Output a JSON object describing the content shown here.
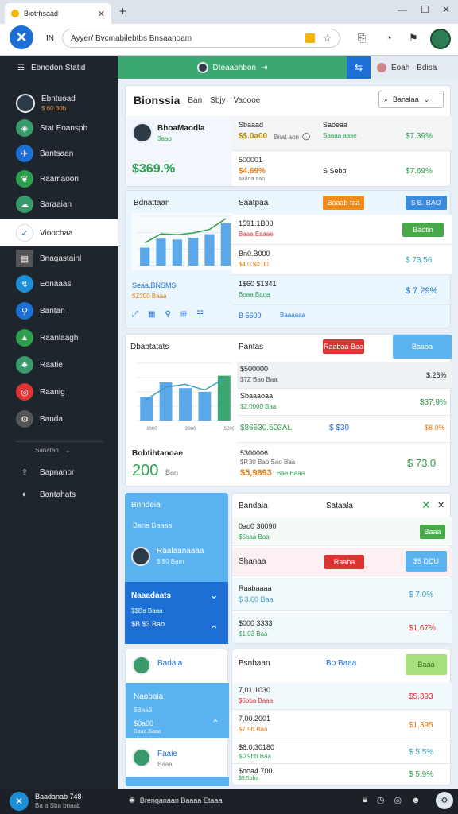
{
  "browser": {
    "tab_title": "Biotrhsaad",
    "new_tab": "+",
    "url_prefix": "IN",
    "url": "Ayyer/ Bvcmabilebtbs Bnsaanoam",
    "win_min": "—",
    "win_max": "☐",
    "win_close": "✕"
  },
  "strip": {
    "left_icon": "☷",
    "left_text": "Ebnodon   Statid",
    "mid_text": "Dteaabhbon",
    "mid_arrow": "⇥",
    "blue_icon": "⇆",
    "right_text": "Eoah  ·  Bdisa"
  },
  "sidebar": {
    "items": [
      {
        "label": "Ebntuoad",
        "sub": "$ 60.30b",
        "color": "#c0703a"
      },
      {
        "label": "Stat Eoansph",
        "color": "#3a9a6a"
      },
      {
        "label": "Bantsaan",
        "color": "#1d6fd6"
      },
      {
        "label": "Raamaoon",
        "color": "#2e9e4f"
      },
      {
        "label": "Saraaian",
        "color": "#3a9a6a"
      },
      {
        "label": "Vioochaa",
        "color": "#1d6fd6"
      },
      {
        "label": "Bnagastainl",
        "color": "#555"
      },
      {
        "label": "Eonaaas",
        "color": "#1d8fd6"
      },
      {
        "label": "Bantan",
        "color": "#1d6fd6"
      },
      {
        "label": "Raanlaagh",
        "color": "#2e9e4f"
      },
      {
        "label": "Raatie",
        "color": "#3a9a6a"
      },
      {
        "label": "Raanig",
        "color": "#d33"
      },
      {
        "label": "Banda",
        "color": "#555"
      }
    ],
    "section_label": "Sanatan",
    "bottom_items": [
      {
        "label": "Bapnanor"
      },
      {
        "label": "Bantahats"
      }
    ]
  },
  "panel1": {
    "title": "Bionssia",
    "tabs": [
      "Ban",
      "Sbjy",
      "Vaoooe"
    ],
    "search_label": "Banslaa",
    "profile_name": "BhoaMaodla",
    "profile_sub": "3aao",
    "profile_value": "$369.%",
    "col_a_label": "Sbaaad",
    "col_a_value": "$$.0a00",
    "col_a_sub": "Bnat  aon",
    "col_b_label": "Saoeaa",
    "col_b_value": "Saaaa aase",
    "col_c_value": "$7.39%",
    "row2_label": "500001",
    "row2_value": "$4.69%",
    "row2_sub": "aaaoa aan",
    "row2_mid": "S  Sebb",
    "row2_right": "$7.69%"
  },
  "panel2": {
    "title": "Bdnattaan",
    "subtitle": "Saatpaa",
    "orange_btn": "Boaab faa",
    "blue_btn": "$ B. BAO",
    "left_sub_title": "Seaa.BNSMS",
    "left_sub_value": "$Z300  Baaa",
    "rows": [
      {
        "label": "1591.1B00",
        "sub": "Baaa  Esaae",
        "right": "Badtin"
      },
      {
        "label": "Bn0.B000",
        "sub": "$4.0.$0.00",
        "right": "$ 73.56"
      },
      {
        "label": "1$60 $1341",
        "sub": "Boaa  Baoa",
        "right": "$ 7.29%"
      },
      {
        "label": "B 5600",
        "sub": "Baaaaaa",
        "right": ""
      }
    ],
    "chart_data": {
      "type": "bar",
      "categories": [
        "1",
        "2",
        "3",
        "4",
        "5",
        "6"
      ],
      "values": [
        20,
        30,
        29,
        31,
        35,
        47
      ],
      "title": "",
      "ylim": [
        0,
        55
      ]
    }
  },
  "panel3": {
    "title": "Dbabtatats",
    "subtitle": "Pantas",
    "red_btn": "Raabaa  Baa",
    "teal_btn": "Baaoa",
    "big_label": "Bobtihtanoae",
    "big_value": "200",
    "big_unit": "Ban",
    "x_ticks": [
      "1000",
      "2000",
      "5000"
    ],
    "rows": [
      {
        "label": "$500000",
        "sub": "$7Z  Bao  Baa",
        "right": "$.26%"
      },
      {
        "label": "Sbaaaoaa",
        "sub": "$2.0000  Baa",
        "right": "$37.9%"
      },
      {
        "label": "$86630.503AL",
        "mid": "$ $30",
        "right": "$8.0%"
      }
    ],
    "bottom_label": "5300006",
    "bottom_sub": "$P.30  Bao  Sao  Baa",
    "bottom_value": "$5,9893",
    "bottom_tag": "Bae  Baaa",
    "bottom_right": "$ 73.0",
    "chart_data": {
      "type": "bar",
      "categories": [
        "1",
        "2",
        "3",
        "4",
        "5"
      ],
      "values": [
        25,
        40,
        34,
        30,
        47
      ],
      "title": "",
      "ylim": [
        0,
        60
      ],
      "line": [
        22,
        35,
        38,
        32,
        44
      ]
    }
  },
  "panel4": {
    "title": "Bnndeia",
    "sub": "Bana  Baaaa",
    "profile_name": "Raalaanaaaa",
    "profile_sub": "$ $0  Bam",
    "dark_title": "Naaadaats",
    "dark_sub": "$$Ba  Baaa",
    "dark_value": "$B $3.Bab",
    "right_title": "Bandaia",
    "right_title2": "Sataala",
    "rows": [
      {
        "label": "0ao0 30090",
        "sub": "$5aaa  Baa",
        "right": "Baaa"
      },
      {
        "label": "Shanaa",
        "btn_red": "Raaba",
        "btn_blue": "$5 DDU"
      },
      {
        "label": "Raabaaaa",
        "sub": "$ 3.60  Baa",
        "right": "$ 7.0%"
      },
      {
        "label": "$000 3333",
        "sub": "$1.03  Baa",
        "right": "$1.67%"
      }
    ]
  },
  "panel5": {
    "profile_name": "Badaia",
    "panel_title": "Naobaia",
    "panel_sub": "$Baa3",
    "panel_value": "$0a00",
    "panel_sub2": "Baaa Baaa",
    "profile2_name": "Faaie",
    "profile2_sub": "Baaa",
    "right_title": "Bsnbaan",
    "right_mid": "Bo Baaa",
    "green_btn": "Baaa",
    "rows": [
      {
        "label": "7,01.1030",
        "sub": "$5bba  Baaa",
        "right": "$5.393"
      },
      {
        "label": "7,00.2001",
        "sub": "$7.5b  Baa",
        "right": "$1.395"
      },
      {
        "label": "$6.0.30180",
        "sub": "$0.9bb  Baa",
        "right": "$ 5.5%"
      },
      {
        "label": "$ooa4.700",
        "sub": "$9.5bba",
        "right": "$ 5.9%"
      }
    ]
  },
  "bottombar": {
    "left_title": "Baadanab 748",
    "left_sub": "Ba a  Sba bnaab",
    "mid_text": "Brenganaan Baaaa Etaaa"
  },
  "colors": {
    "accent": "#1d6fd6",
    "green": "#2e9e4f",
    "sidebar": "#1f252d",
    "light_blue": "#dbeefa"
  }
}
